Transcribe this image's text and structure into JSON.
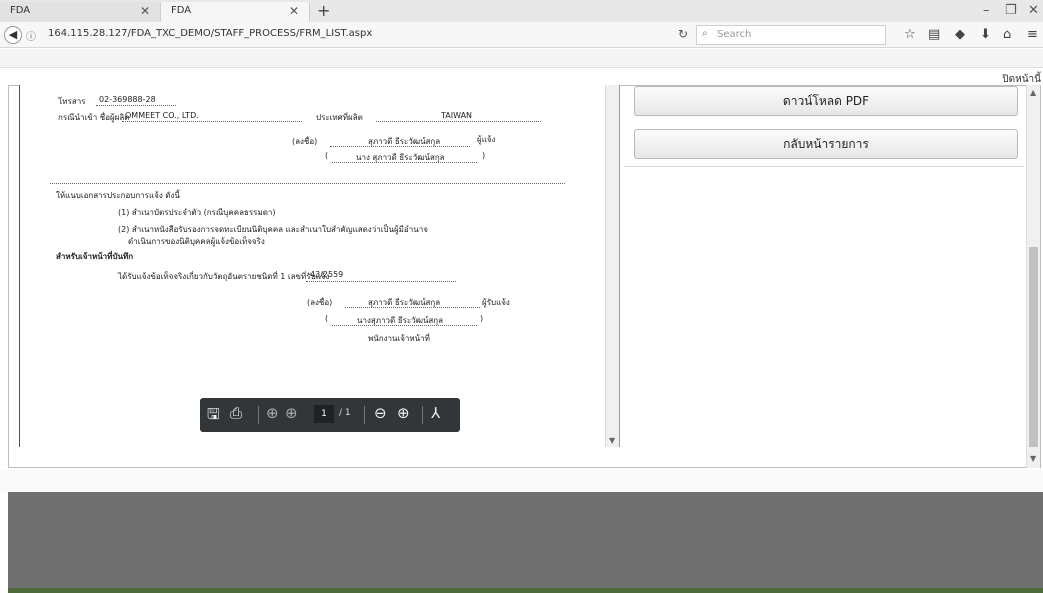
{
  "browser": {
    "tabs": [
      {
        "label": "FDA",
        "active": false
      },
      {
        "label": "FDA",
        "active": true
      }
    ],
    "url": "164.115.28.127/FDA_TXC_DEMO/STAFF_PROCESS/FRM_LIST.aspx",
    "search_placeholder": "Search",
    "back_home": "ปิดหน้านี้"
  },
  "document": {
    "lines": [
      {
        "key": "fax_label",
        "text": "โทรสาร"
      },
      {
        "key": "fax_value",
        "text": "02-369888-28"
      },
      {
        "key": "importer_label",
        "text": "กรณีนำเข้า ชื่อผู้ผลิต"
      },
      {
        "key": "manufacturer",
        "text": "OMMEET CO., LTD."
      },
      {
        "key": "country_label",
        "text": "ประเทศที่ผลิต"
      },
      {
        "key": "country",
        "text": "TAIWAN"
      },
      {
        "key": "sign_label1",
        "text": "(ลงชื่อ)"
      },
      {
        "key": "signer1",
        "text": "สุภาวดี ธีระวัฒน์สกุล"
      },
      {
        "key": "role1",
        "text": "ผู้แจ้ง"
      },
      {
        "key": "signer1_full",
        "text": "นาง สุภาวดี ธีระวัฒน์สกุล"
      },
      {
        "key": "attach_heading",
        "text": "ให้แนบเอกสารประกอบการแจ้ง ดังนี้"
      },
      {
        "key": "attach1",
        "text": "(1) สำเนาบัตรประจำตัว (กรณีบุคคลธรรมดา)"
      },
      {
        "key": "attach2a",
        "text": "(2) สำเนาหนังสือรับรองการจดทะเบียนนิติบุคคล และสำเนาใบสำคัญแสดงว่าเป็นผู้มีอำนาจ"
      },
      {
        "key": "attach2b",
        "text": "ดำเนินการของนิติบุคคลผู้แจ้งข้อเท็จจริง"
      },
      {
        "key": "officer_heading",
        "text": "สำหรับเจ้าหน้าที่บันทึก"
      },
      {
        "key": "received_text",
        "text": "ได้รับแจ้งข้อเท็จจริงเกี่ยวกับวัตถุอันตรายชนิดที่ 1 เลขที่รับแจ้ง"
      },
      {
        "key": "received_no",
        "text": "43/2559"
      },
      {
        "key": "sign_label2",
        "text": "(ลงชื่อ)"
      },
      {
        "key": "signer2",
        "text": "สุภาวดี ธีระวัฒน์สกุล"
      },
      {
        "key": "role2",
        "text": "ผู้รับแจ้ง"
      },
      {
        "key": "signer2_full",
        "text": "นางสุภาวดี ธีระวัฒน์สกุล"
      },
      {
        "key": "officer_title",
        "text": "พนักงานเจ้าหน้าที่"
      }
    ]
  },
  "pdf_toolbar": {
    "page_current": "1",
    "page_total": "/ 1"
  },
  "actions": {
    "download_pdf": "ดาวน์โหลด PDF",
    "back_to_list": "กลับหน้ารายการ"
  }
}
